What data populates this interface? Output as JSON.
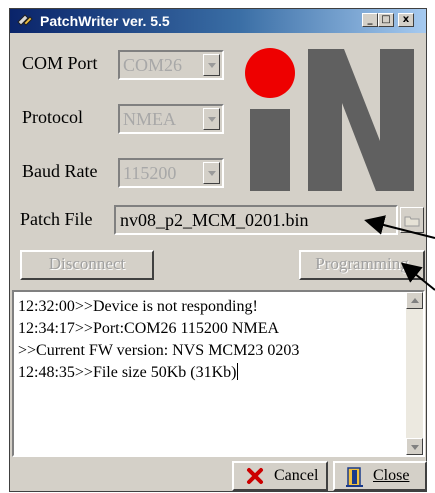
{
  "window": {
    "title": "PatchWriter ver. 5.5",
    "title_buttons": {
      "minimize": "_",
      "maximize": "□",
      "close": "x"
    }
  },
  "settings": {
    "com_port": {
      "label": "COM Port",
      "value": "COM26"
    },
    "protocol": {
      "label": "Protocol",
      "value": "NMEA"
    },
    "baud_rate": {
      "label": "Baud Rate",
      "value": "115200"
    },
    "patch_file": {
      "label": "Patch File",
      "value": "nv08_p2_MCM_0201.bin"
    }
  },
  "buttons": {
    "disconnect": "Disconnect",
    "programming": "Programming",
    "cancel": "Cancel",
    "close": "Close"
  },
  "log": {
    "lines": [
      "12:32:00>>Device is not responding!",
      "12:34:17>>Port:COM26 115200 NMEA",
      ">>Current FW version: NVS MCM23 0203",
      "12:48:35>>File size 50Kb (31Kb)"
    ]
  },
  "icons": {
    "title": "satellite-icon",
    "browse": "folder-icon",
    "cancel": "red-x-icon",
    "close": "door-exit-icon",
    "logo": "nv-logo-red-dot"
  },
  "colors": {
    "logo_red": "#ee0000",
    "logo_gray": "#606060",
    "title_bar": "#0a246a",
    "cancel_icon": "#cc0000",
    "close_icon": "#1a3a8a"
  }
}
